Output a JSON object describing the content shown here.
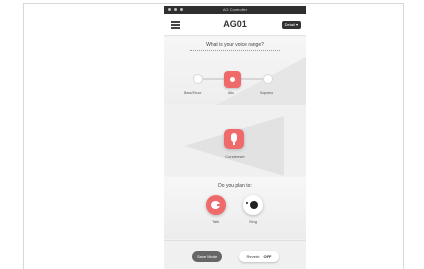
{
  "window": {
    "title": "AG Controller"
  },
  "header": {
    "title": "AG01",
    "mode_button": "Detail ▾"
  },
  "voice_range": {
    "question": "What is your voice range?",
    "options": [
      "Bass/Tenor",
      "Alto",
      "Soprano"
    ],
    "selected": "Alto"
  },
  "mic": {
    "label": "Condenser"
  },
  "usage": {
    "question": "Do you plan to:",
    "options": [
      {
        "label": "Talk",
        "icon": "talk-icon",
        "selected": true
      },
      {
        "label": "Sing",
        "icon": "sing-icon",
        "selected": false
      }
    ]
  },
  "bottom": {
    "save_label": "Save Mode",
    "reverb_label": "Reverb",
    "reverb_value": "OFF"
  },
  "colors": {
    "accent": "#ef6b6b",
    "dark": "#333333",
    "background": "#f2f2f2"
  }
}
